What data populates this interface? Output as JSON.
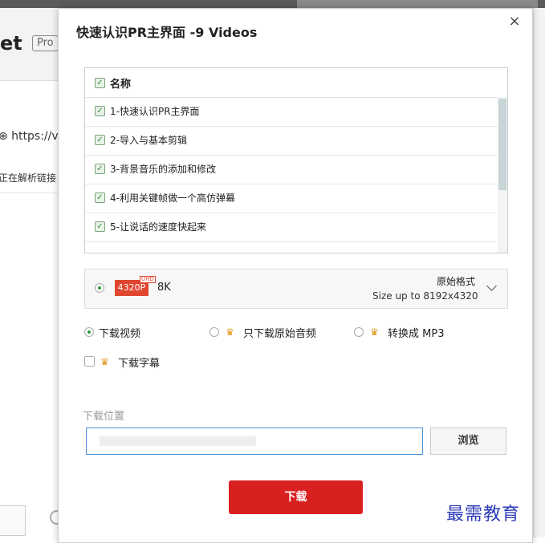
{
  "background": {
    "title": "et",
    "badge": "Pro",
    "url": "⊕ https://v",
    "status": "正在解析链接"
  },
  "dialog": {
    "title": "快速认识PR主界面 -9 Videos",
    "close_icon": "×",
    "list": {
      "header": "名称",
      "items": [
        "1-快速认识PR主界面",
        "2-导入与基本剪辑",
        "3-背景音乐的添加和修改",
        "4-利用关键帧做一个高仿弹幕",
        "5-让说话的速度快起来"
      ]
    },
    "format": {
      "resolution_badge": "4320P",
      "uhd_tag": "UHD",
      "resolution_label": "8K",
      "format_name": "原始格式",
      "size_text": "Size up to 8192x4320"
    },
    "options": {
      "video": "下载视频",
      "audio_only": "只下载原始音频",
      "mp3": "转换成 MP3",
      "subtitles": "下载字幕"
    },
    "location": {
      "label": "下载位置",
      "value": "",
      "browse": "浏览"
    },
    "download": "下载"
  },
  "watermark": "最需教育",
  "colors": {
    "accent_red": "#d92020",
    "check_green": "#3a8a3a",
    "crown": "#e2951c",
    "input_border": "#4a90d9",
    "badge_red": "#e0462f"
  }
}
